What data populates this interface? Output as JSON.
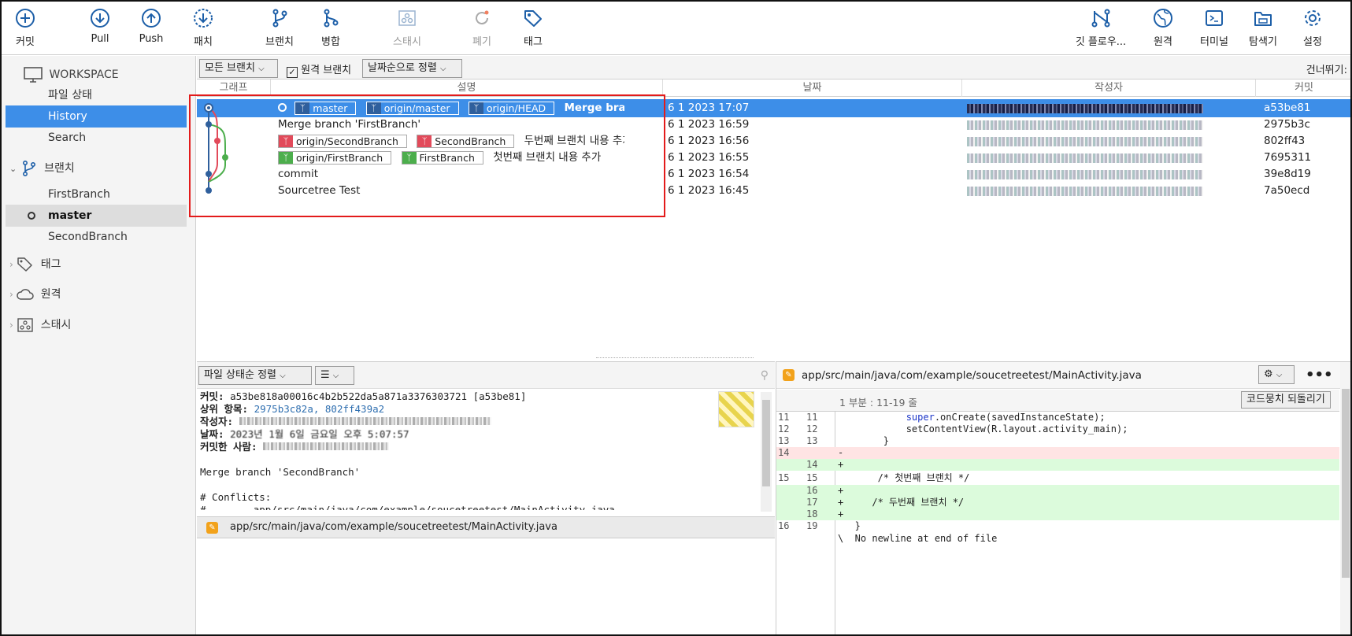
{
  "toolbar": {
    "commit": "커밋",
    "pull": "Pull",
    "push": "Push",
    "fetch": "패치",
    "branch": "브랜치",
    "merge": "병합",
    "stash": "스태시",
    "discard": "폐기",
    "tag": "태그",
    "gitflow": "깃 플로우...",
    "remote": "원격",
    "terminal": "터미널",
    "explorer": "탐색기",
    "settings": "설정"
  },
  "sidebar": {
    "workspace": "WORKSPACE",
    "workspace_items": [
      "파일 상태",
      "History",
      "Search"
    ],
    "branches_header": "브랜치",
    "branches": [
      "FirstBranch",
      "master",
      "SecondBranch"
    ],
    "tags_header": "태그",
    "remotes_header": "원격",
    "stash_header": "스태시"
  },
  "filter": {
    "all_branches": "모든 브랜치",
    "remote_branches": "원격 브랜치",
    "sort": "날짜순으로 정렬",
    "jump": "건너뛰기:"
  },
  "columns": {
    "graph": "그래프",
    "desc": "설명",
    "date": "날짜",
    "author": "작성자",
    "commit": "커밋"
  },
  "commits": [
    {
      "refs": [
        {
          "name": "master",
          "color": "#2f5f9c"
        },
        {
          "name": "origin/master",
          "color": "#2f5f9c"
        },
        {
          "name": "origin/HEAD",
          "color": "#2f5f9c"
        }
      ],
      "message": "Merge branch 'SecondBranch'",
      "date": "6 1 2023 17:07",
      "hash": "a53be81"
    },
    {
      "refs": [],
      "message": "Merge branch 'FirstBranch'",
      "date": "6 1 2023 16:59",
      "hash": "2975b3c"
    },
    {
      "refs": [
        {
          "name": "origin/SecondBranch",
          "color": "#e24a5a"
        },
        {
          "name": "SecondBranch",
          "color": "#e24a5a"
        }
      ],
      "message": "두번째 브랜치 내용 추가",
      "date": "6 1 2023 16:56",
      "hash": "802ff43"
    },
    {
      "refs": [
        {
          "name": "origin/FirstBranch",
          "color": "#4cae4c"
        },
        {
          "name": "FirstBranch",
          "color": "#4cae4c"
        }
      ],
      "message": "첫번째 브랜치 내용 추가",
      "date": "6 1 2023 16:55",
      "hash": "7695311"
    },
    {
      "refs": [],
      "message": "commit",
      "date": "6 1 2023 16:54",
      "hash": "39e8d19"
    },
    {
      "refs": [],
      "message": "Sourcetree Test",
      "date": "6 1 2023 16:45",
      "hash": "7a50ecd"
    }
  ],
  "lower": {
    "sort_label": "파일 상태순 정렬",
    "commit_label": "커밋:",
    "commit_full": "a53be818a00016c4b2b522da5a871a3376303721 [a53be81]",
    "parents_label": "상위 항목:",
    "parents": "2975b3c82a, 802ff439a2",
    "author_label": "작성자:",
    "date_label": "날짜:",
    "date_value": "2023년 1월 6일 금요일 오후 5:07:57",
    "committer_label": "커밋한 사람:",
    "message": "Merge branch 'SecondBranch'",
    "conflicts": "# Conflicts:",
    "conflict_file": "#        app/src/main/java/com/example/soucetreetest/MainActivity.java",
    "file": "app/src/main/java/com/example/soucetreetest/MainActivity.java"
  },
  "diff": {
    "path": "app/src/main/java/com/example/soucetreetest/MainActivity.java",
    "hunk": "1 부분 : 11-19 줄",
    "revert": "코드뭉치 되돌리기",
    "lines": [
      {
        "n1": "11",
        "n2": "11",
        "t": "            super.onCreate(savedInstanceState);",
        "k": ""
      },
      {
        "n1": "12",
        "n2": "12",
        "t": "            setContentView(R.layout.activity_main);",
        "k": ""
      },
      {
        "n1": "13",
        "n2": "13",
        "t": "        }",
        "k": ""
      },
      {
        "n1": "14",
        "n2": "",
        "t": "-    ",
        "k": "del"
      },
      {
        "n1": "",
        "n2": "14",
        "t": "+",
        "k": "add"
      },
      {
        "n1": "15",
        "n2": "15",
        "t": "       /* 첫번째 브랜치 */",
        "k": ""
      },
      {
        "n1": "",
        "n2": "16",
        "t": "+",
        "k": "add"
      },
      {
        "n1": "",
        "n2": "17",
        "t": "+     /* 두번째 브랜치 */",
        "k": "add"
      },
      {
        "n1": "",
        "n2": "18",
        "t": "+",
        "k": "add"
      },
      {
        "n1": "16",
        "n2": "19",
        "t": "   }",
        "k": ""
      },
      {
        "n1": "",
        "n2": "",
        "t": "\\  No newline at end of file",
        "k": ""
      }
    ]
  },
  "colors": {
    "accent": "#3d8ee8",
    "highlight_box": "#e31b1b",
    "icon": "#1d5fa8"
  }
}
